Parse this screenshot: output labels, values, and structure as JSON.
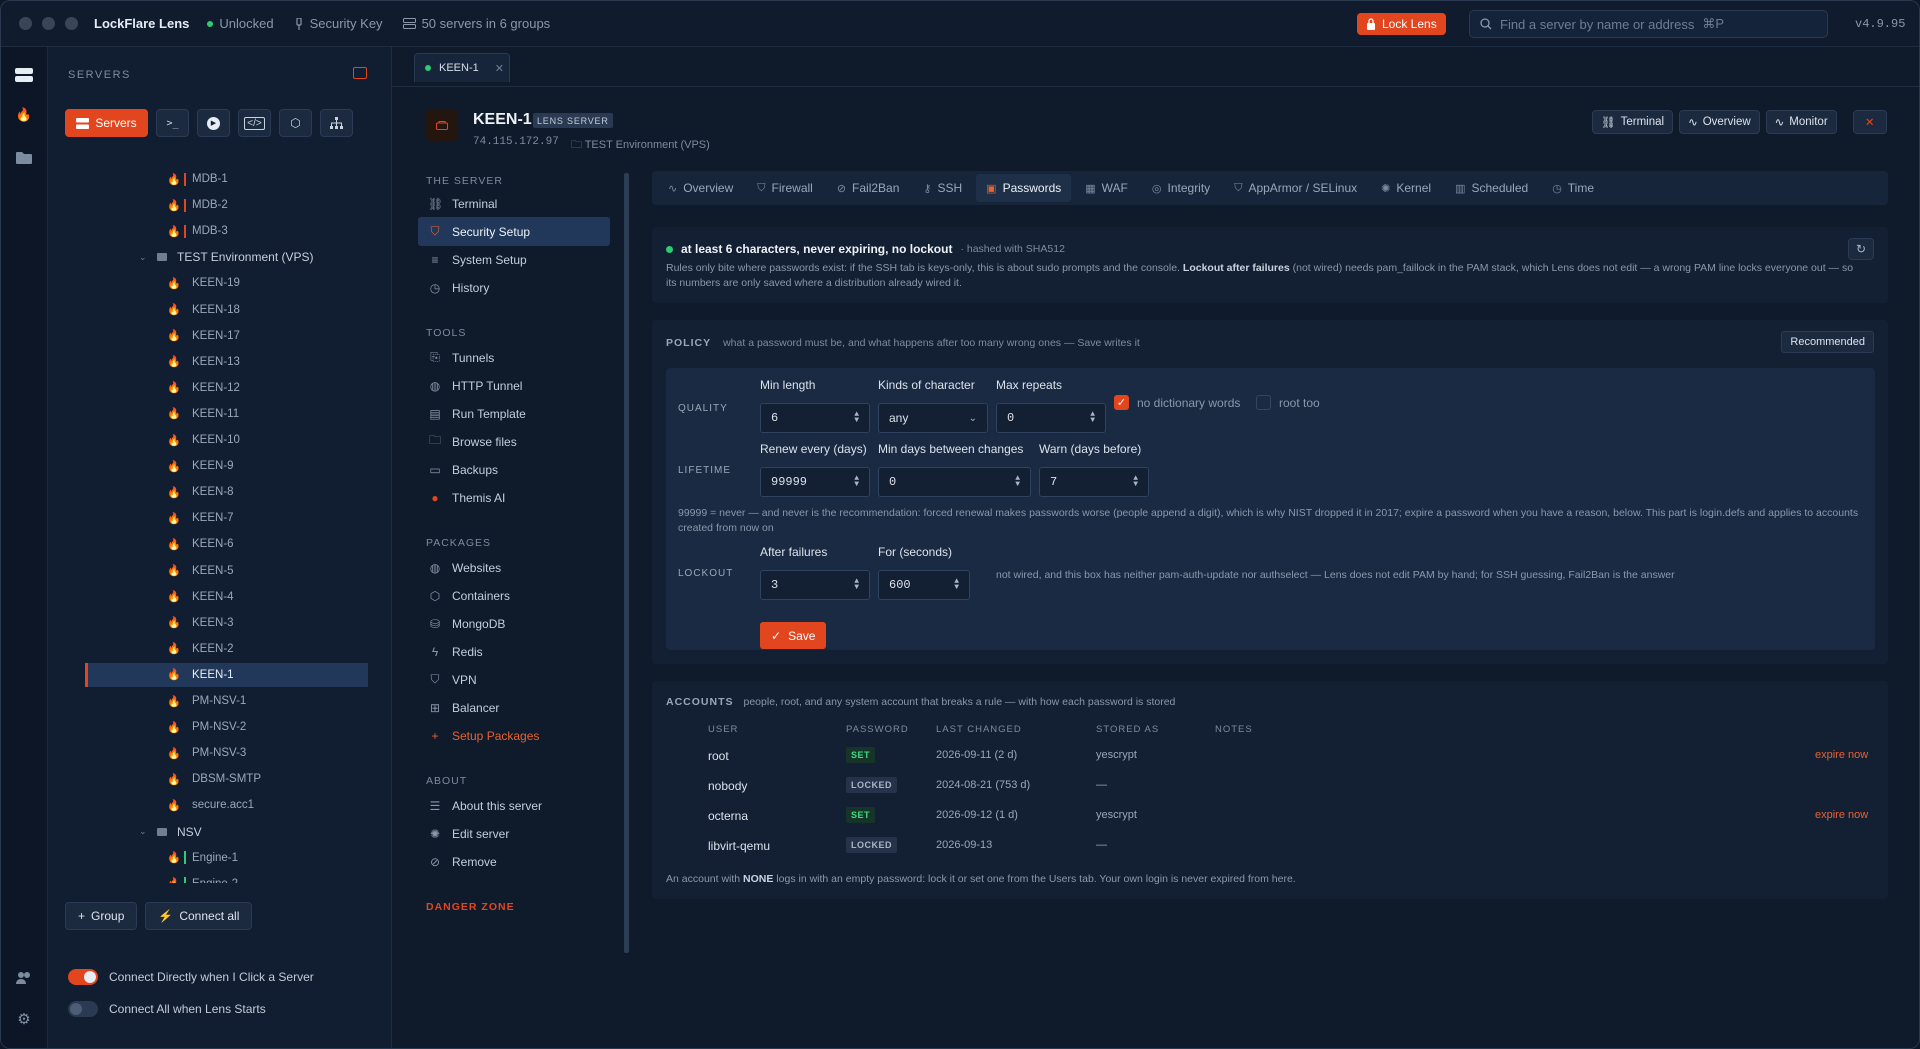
{
  "app": {
    "name": "LockFlare Lens",
    "status": "Unlocked",
    "key": "Security Key",
    "servers_summary": "50 servers in 6 groups",
    "lock_label": "Lock Lens",
    "search_placeholder": "Find a server by name or address",
    "search_shortcut": "⌘P",
    "version": "v4.9.95"
  },
  "sidebar": {
    "heading": "SERVERS",
    "servers_btn": "Servers",
    "tree": [
      {
        "name": "MDB-1",
        "bar": "#e2461f",
        "type": "server"
      },
      {
        "name": "MDB-2",
        "bar": "#e2461f",
        "type": "server"
      },
      {
        "name": "MDB-3",
        "bar": "#e2461f",
        "type": "server"
      },
      {
        "name": "TEST Environment (VPS)",
        "type": "group"
      },
      {
        "name": "KEEN-19",
        "type": "server"
      },
      {
        "name": "KEEN-18",
        "type": "server"
      },
      {
        "name": "KEEN-17",
        "type": "server"
      },
      {
        "name": "KEEN-13",
        "type": "server"
      },
      {
        "name": "KEEN-12",
        "type": "server"
      },
      {
        "name": "KEEN-11",
        "type": "server"
      },
      {
        "name": "KEEN-10",
        "type": "server"
      },
      {
        "name": "KEEN-9",
        "type": "server"
      },
      {
        "name": "KEEN-8",
        "type": "server"
      },
      {
        "name": "KEEN-7",
        "type": "server"
      },
      {
        "name": "KEEN-6",
        "type": "server"
      },
      {
        "name": "KEEN-5",
        "type": "server"
      },
      {
        "name": "KEEN-4",
        "type": "server"
      },
      {
        "name": "KEEN-3",
        "type": "server"
      },
      {
        "name": "KEEN-2",
        "type": "server"
      },
      {
        "name": "KEEN-1",
        "type": "server",
        "selected": true
      },
      {
        "name": "PM-NSV-1",
        "type": "server"
      },
      {
        "name": "PM-NSV-2",
        "type": "server"
      },
      {
        "name": "PM-NSV-3",
        "type": "server"
      },
      {
        "name": "DBSM-SMTP",
        "type": "server"
      },
      {
        "name": "secure.acc1",
        "type": "server"
      },
      {
        "name": "NSV",
        "type": "group"
      },
      {
        "name": "Engine-1",
        "bar": "#2ecc71",
        "type": "server"
      },
      {
        "name": "Engine-2",
        "bar": "#2ecc71",
        "type": "server"
      }
    ],
    "group_btn": "Group",
    "connect_all_btn": "Connect all",
    "toggle1": "Connect Directly when I Click a Server",
    "toggle2": "Connect All when Lens Starts"
  },
  "tab": {
    "label": "KEEN-1"
  },
  "server": {
    "name": "KEEN-1",
    "badge": "LENS SERVER",
    "ip": "74.115.172.97",
    "group": "TEST Environment (VPS)"
  },
  "header_btns": {
    "terminal": "Terminal",
    "overview": "Overview",
    "monitor": "Monitor"
  },
  "nav": {
    "the_server": "THE SERVER",
    "tools": "TOOLS",
    "packages": "PACKAGES",
    "about": "ABOUT",
    "danger": "DANGER ZONE",
    "items": [
      "Terminal",
      "Security Setup",
      "System Setup",
      "History",
      "Tunnels",
      "HTTP Tunnel",
      "Run Template",
      "Browse files",
      "Backups",
      "Themis AI",
      "Websites",
      "Containers",
      "MongoDB",
      "Redis",
      "VPN",
      "Balancer",
      "Setup Packages",
      "About this server",
      "Edit server",
      "Remove"
    ]
  },
  "sec_tabs": [
    "Overview",
    "Firewall",
    "Fail2Ban",
    "SSH",
    "Passwords",
    "WAF",
    "Integrity",
    "AppArmor / SELinux",
    "Kernel",
    "Scheduled",
    "Time"
  ],
  "summary": {
    "title": "at least 6 characters, never expiring, no lockout",
    "hash": "· hashed with SHA512",
    "desc_a": "Rules only bite where passwords exist: if the SSH tab is keys-only, this is about sudo prompts and the console. ",
    "desc_b": "Lockout after failures",
    "desc_c": " (not wired) needs pam_faillock in the PAM stack, which Lens does not edit — a wrong PAM line locks everyone out — so its numbers are only saved where a distribution already wired it."
  },
  "policy": {
    "key": "POLICY",
    "desc": "what a password must be, and what happens after too many wrong ones — Save writes it",
    "recommended": "Recommended",
    "quality": "QUALITY",
    "lifetime": "LIFETIME",
    "lockout": "LOCKOUT",
    "min_length_lbl": "Min length",
    "min_length": "6",
    "kinds_lbl": "Kinds of character",
    "kinds": "any",
    "max_rep_lbl": "Max repeats",
    "max_rep": "0",
    "no_dict": "no dictionary words",
    "root_too": "root too",
    "renew_lbl": "Renew every (days)",
    "renew": "99999",
    "min_days_lbl": "Min days between changes",
    "min_days": "0",
    "warn_lbl": "Warn (days before)",
    "warn": "7",
    "lifetime_note": "99999 = never — and never is the recommendation: forced renewal makes passwords worse (people append a digit), which is why NIST dropped it in 2017; expire a password when you have a reason, below. This part is login.defs and applies to accounts created from now on",
    "after_fail_lbl": "After failures",
    "after_fail": "3",
    "for_sec_lbl": "For (seconds)",
    "for_sec": "600",
    "lockout_note": "not wired, and this box has neither pam-auth-update nor authselect — Lens does not edit PAM by hand; for SSH guessing, Fail2Ban is the answer",
    "save": "Save"
  },
  "accounts": {
    "key": "ACCOUNTS",
    "desc": "people, root, and any system account that breaks a rule — with how each password is stored",
    "cols": [
      "USER",
      "PASSWORD",
      "LAST CHANGED",
      "STORED AS",
      "NOTES"
    ],
    "rows": [
      {
        "user": "root",
        "pw": "SET",
        "changed": "2026-09-11 (2 d)",
        "stored": "yescrypt",
        "action": "expire now"
      },
      {
        "user": "nobody",
        "pw": "LOCKED",
        "changed": "2024-08-21 (753 d)",
        "stored": "—",
        "action": ""
      },
      {
        "user": "octerna",
        "pw": "SET",
        "changed": "2026-09-12 (1 d)",
        "stored": "yescrypt",
        "action": "expire now"
      },
      {
        "user": "libvirt-qemu",
        "pw": "LOCKED",
        "changed": "2026-09-13",
        "stored": "—",
        "action": ""
      }
    ],
    "foot_a": "An account with ",
    "foot_b": "NONE",
    "foot_c": " logs in with an empty password: lock it or set one from the Users tab. Your own login is never expired from here."
  }
}
